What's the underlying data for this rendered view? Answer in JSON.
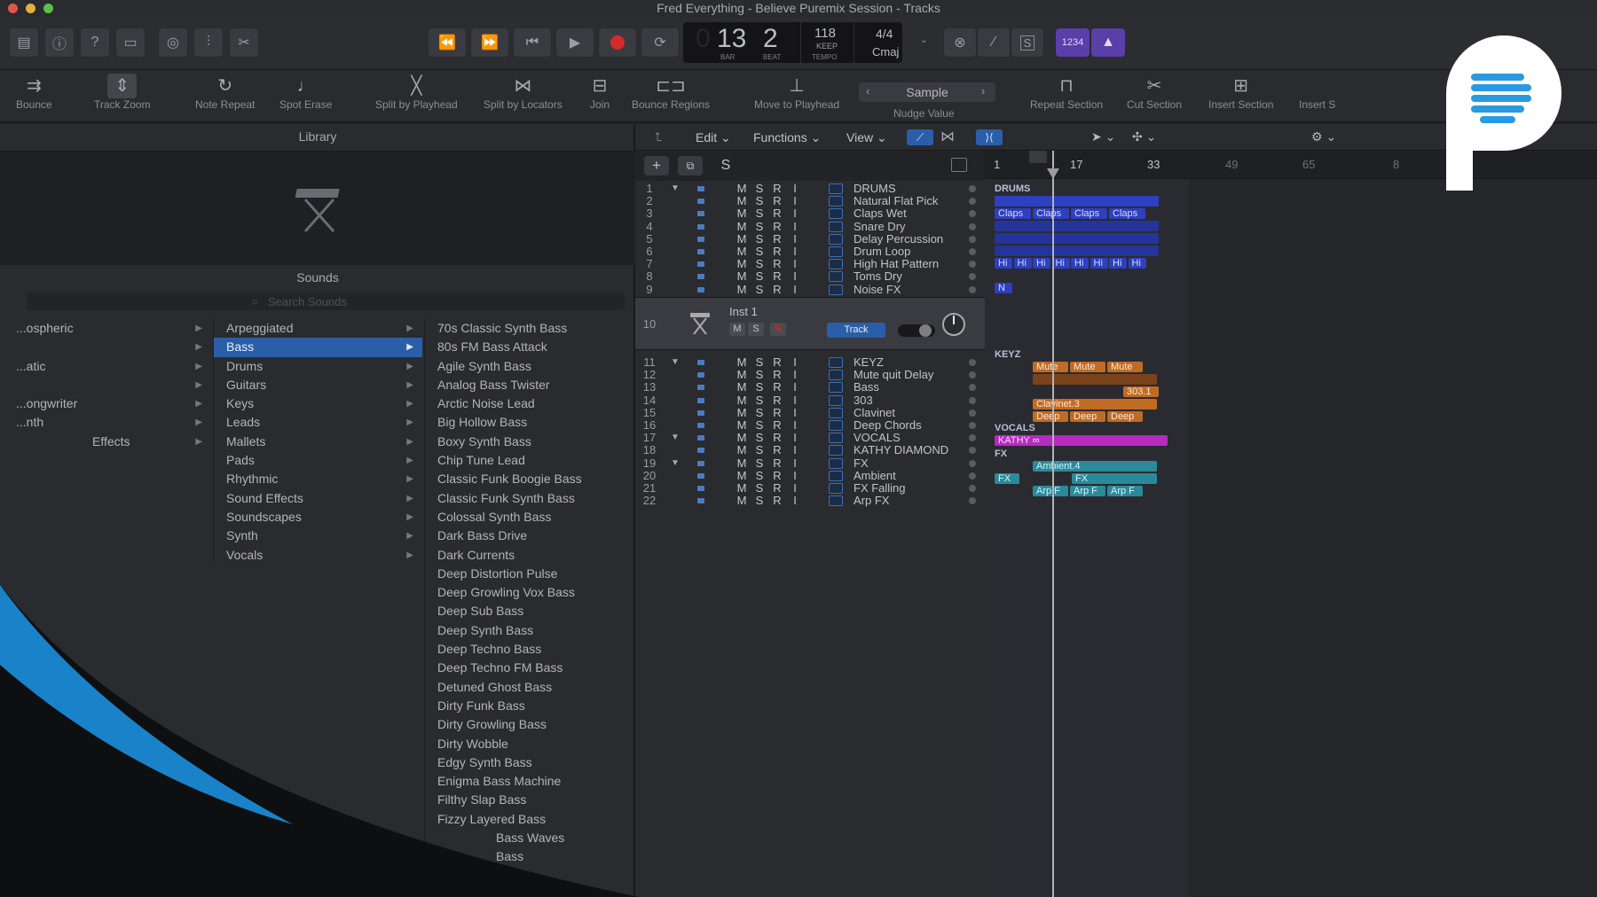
{
  "window": {
    "title": "Fred Everything - Believe Puremix Session - Tracks"
  },
  "colors": {
    "accent": "#2b5ea8",
    "drums": "#2e3fbf",
    "keys": "#c06b24",
    "vocals": "#b52bc0",
    "fx": "#2a8a9a",
    "record": "#d62a2a"
  },
  "control": {
    "lcd": {
      "bar": "13",
      "beat": "2",
      "bar_label": "BAR",
      "beat_label": "BEAT",
      "tempo": "118",
      "keep": "KEEP",
      "tempo_label": "TEMPO",
      "time_sig": "4/4",
      "key": "Cmaj"
    },
    "count_in": "1234",
    "solo_label": "S"
  },
  "toolbar": {
    "bounce": "Bounce",
    "track_zoom": "Track Zoom",
    "note_repeat": "Note Repeat",
    "spot_erase": "Spot Erase",
    "split_playhead": "Split by Playhead",
    "split_locators": "Split by Locators",
    "join": "Join",
    "bounce_regions": "Bounce Regions",
    "move_playhead": "Move to Playhead",
    "nudge_value": "Nudge Value",
    "nudge_current": "Sample",
    "repeat_section": "Repeat Section",
    "cut_section": "Cut Section",
    "insert_section": "Insert Section",
    "insert_s": "Insert S"
  },
  "library": {
    "title": "Library",
    "sounds": "Sounds",
    "search_placeholder": "Search Sounds",
    "categories": [
      {
        "label": "...ospheric"
      },
      {
        "label": ""
      },
      {
        "label": "...atic"
      },
      {
        "label": ""
      },
      {
        "label": "...ongwriter"
      },
      {
        "label": "...nth"
      },
      {
        "label": "Effects"
      }
    ],
    "subcategories": [
      {
        "label": "Arpeggiated"
      },
      {
        "label": "Bass"
      },
      {
        "label": "Drums"
      },
      {
        "label": "Guitars"
      },
      {
        "label": "Keys"
      },
      {
        "label": "Leads"
      },
      {
        "label": "Mallets"
      },
      {
        "label": "Pads"
      },
      {
        "label": "Rhythmic"
      },
      {
        "label": "Sound Effects"
      },
      {
        "label": "Soundscapes"
      },
      {
        "label": "Synth"
      },
      {
        "label": "Vocals"
      }
    ],
    "patches": [
      "70s Classic Synth Bass",
      "80s FM Bass Attack",
      "Agile Synth Bass",
      "Analog Bass Twister",
      "Arctic Noise Lead",
      "Big Hollow Bass",
      "Boxy Synth Bass",
      "Chip Tune Lead",
      "Classic Funk Boogie Bass",
      "Classic Funk Synth Bass",
      "Colossal Synth Bass",
      "Dark Bass Drive",
      "Dark Currents",
      "Deep Distortion Pulse",
      "Deep Growling Vox Bass",
      "Deep Sub Bass",
      "Deep Synth Bass",
      "Deep Techno Bass",
      "Deep Techno FM Bass",
      "Detuned Ghost Bass",
      "Dirty Funk Bass",
      "Dirty Growling Bass",
      "Dirty Wobble",
      "Edgy Synth Bass",
      "Enigma Bass Machine",
      "Filthy Slap Bass",
      "Fizzy Layered Bass",
      "Bass Waves",
      "Bass"
    ]
  },
  "tracks_menu": {
    "edit": "Edit",
    "functions": "Functions",
    "view": "View"
  },
  "ruler": [
    "1",
    "17",
    "33",
    "49",
    "65",
    "8"
  ],
  "tracks": [
    {
      "num": "1",
      "name": "DRUMS"
    },
    {
      "num": "2",
      "name": "Natural Flat Pick"
    },
    {
      "num": "3",
      "name": "Claps Wet"
    },
    {
      "num": "4",
      "name": "Snare Dry"
    },
    {
      "num": "5",
      "name": "Delay Percussion"
    },
    {
      "num": "6",
      "name": "Drum Loop"
    },
    {
      "num": "7",
      "name": "High Hat Pattern"
    },
    {
      "num": "8",
      "name": "Toms Dry"
    },
    {
      "num": "9",
      "name": "Noise FX"
    },
    {
      "num": "11",
      "name": "KEYZ"
    },
    {
      "num": "12",
      "name": "Mute quit Delay"
    },
    {
      "num": "13",
      "name": "Bass"
    },
    {
      "num": "14",
      "name": "303"
    },
    {
      "num": "15",
      "name": "Clavinet"
    },
    {
      "num": "16",
      "name": "Deep Chords"
    },
    {
      "num": "17",
      "name": "VOCALS"
    },
    {
      "num": "18",
      "name": "KATHY DIAMOND"
    },
    {
      "num": "19",
      "name": "FX"
    },
    {
      "num": "20",
      "name": "Ambient"
    },
    {
      "num": "21",
      "name": "FX Falling"
    },
    {
      "num": "22",
      "name": "Arp FX"
    }
  ],
  "msri": {
    "m": "M",
    "s": "S",
    "r": "R",
    "i": "I"
  },
  "inst_track": {
    "num": "10",
    "name": "Inst 1",
    "track_btn": "Track",
    "m": "M",
    "s": "S",
    "r": "R"
  },
  "regions": {
    "drums_group": "DRUMS",
    "keyz_group": "KEYZ",
    "vocals_group": "VOCALS",
    "fx_group": "FX",
    "claps": "Claps",
    "hi": "Hi",
    "n": "N",
    "mute": "Mute",
    "r303": "303.1",
    "clavinet": "Clavinet.3",
    "deep": "Deep",
    "kathy": "KATHY",
    "ambient": "Ambient.4",
    "fx": "FX",
    "arp": "Arp F"
  }
}
